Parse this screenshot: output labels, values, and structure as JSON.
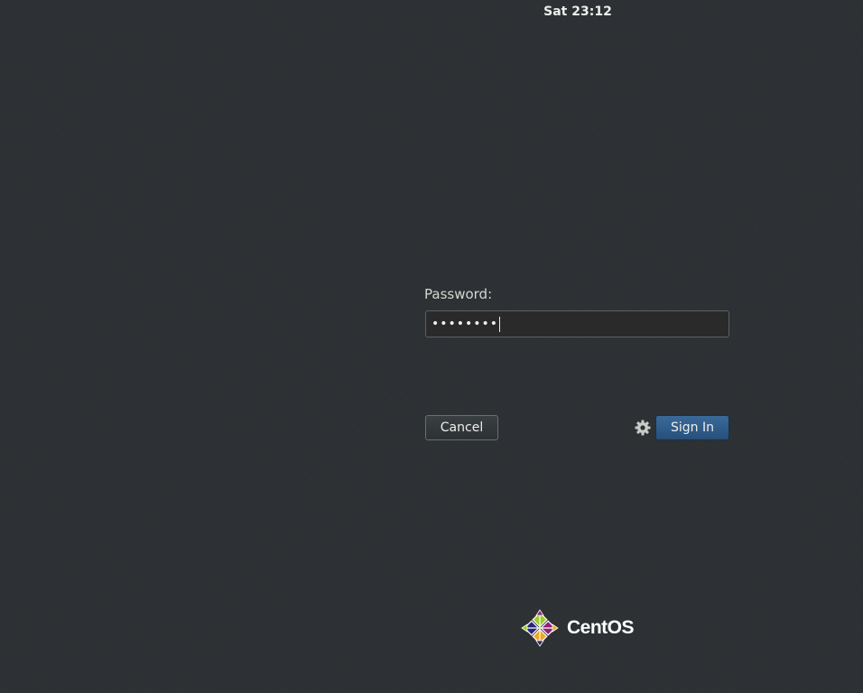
{
  "topbar": {
    "clock": "Sat 23:12"
  },
  "login": {
    "password_label": "Password:",
    "password_masked": "••••••••",
    "cancel_label": "Cancel",
    "signin_label": "Sign In",
    "settings_icon": "gear-icon"
  },
  "branding": {
    "logo_text": "CentOS"
  },
  "colors": {
    "background": "#2d3134",
    "signin_button": "#305b86",
    "field_background": "#2a2a2a"
  }
}
